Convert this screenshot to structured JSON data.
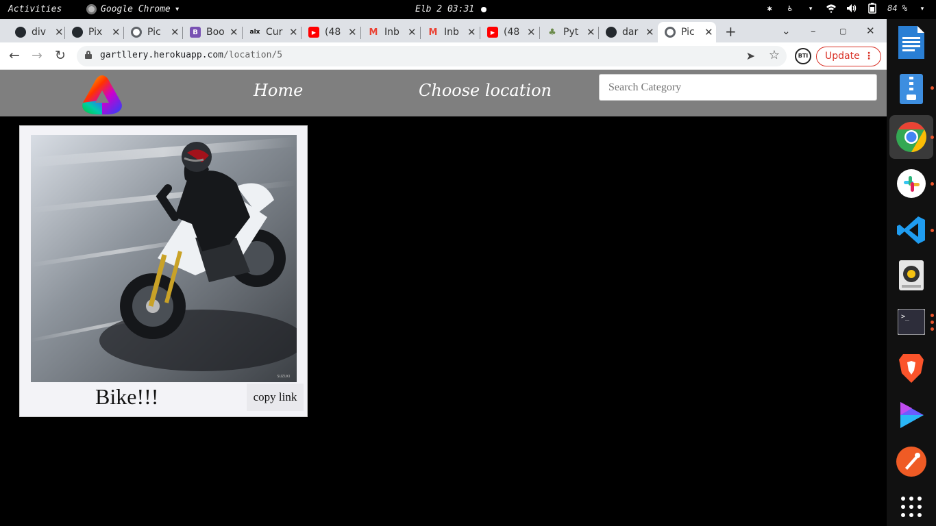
{
  "system_bar": {
    "activities": "Activities",
    "app_name": "Google Chrome",
    "clock": "Elb 2 03:31",
    "battery": "84 %"
  },
  "tabs": [
    {
      "label": "div",
      "icon": "github-icon",
      "color": "#24292e"
    },
    {
      "label": "Pix",
      "icon": "github-icon",
      "color": "#24292e"
    },
    {
      "label": "Pic",
      "icon": "globe-icon",
      "color": "#5f6368"
    },
    {
      "label": "Boo",
      "icon": "bootstrap-icon",
      "color": "#7952b3"
    },
    {
      "label": "Cur",
      "icon": "alx-icon",
      "color": "#111111"
    },
    {
      "label": "(48",
      "icon": "youtube-icon",
      "color": "#ff0000"
    },
    {
      "label": "Inb",
      "icon": "gmail-icon",
      "color": "#ea4335"
    },
    {
      "label": "Inb",
      "icon": "gmail-icon",
      "color": "#ea4335"
    },
    {
      "label": "(48",
      "icon": "youtube-icon",
      "color": "#ff0000"
    },
    {
      "label": "Pyt",
      "icon": "tree-icon",
      "color": "#6a8a4a"
    },
    {
      "label": "dar",
      "icon": "github-icon",
      "color": "#24292e"
    },
    {
      "label": "Pic",
      "icon": "globe-icon",
      "color": "#5f6368"
    }
  ],
  "browser": {
    "url_host": "gartllery.herokuapp.com",
    "url_path": "/location/5",
    "extension_label": "BTI",
    "update_label": "Update",
    "accent": "#d93025"
  },
  "site": {
    "nav_home": "Home",
    "nav_choose_location": "Choose location",
    "search_placeholder": "Search Category",
    "nav_bg": "#7f7f7f"
  },
  "card": {
    "caption": "Bike!!!",
    "copy_label": "copy link"
  }
}
